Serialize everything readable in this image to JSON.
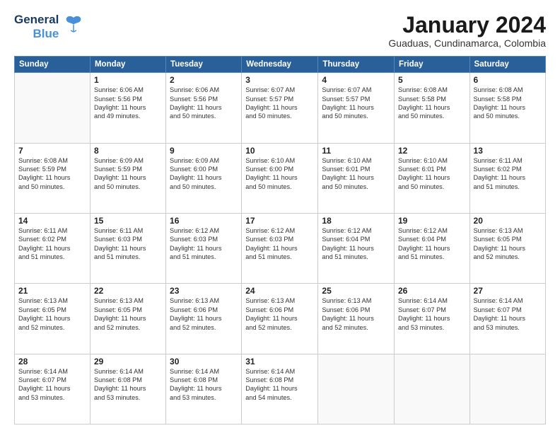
{
  "logo": {
    "line1": "General",
    "line2": "Blue"
  },
  "title": "January 2024",
  "subtitle": "Guaduas, Cundinamarca, Colombia",
  "weekdays": [
    "Sunday",
    "Monday",
    "Tuesday",
    "Wednesday",
    "Thursday",
    "Friday",
    "Saturday"
  ],
  "weeks": [
    [
      {
        "day": "",
        "info": ""
      },
      {
        "day": "1",
        "info": "Sunrise: 6:06 AM\nSunset: 5:56 PM\nDaylight: 11 hours\nand 49 minutes."
      },
      {
        "day": "2",
        "info": "Sunrise: 6:06 AM\nSunset: 5:56 PM\nDaylight: 11 hours\nand 50 minutes."
      },
      {
        "day": "3",
        "info": "Sunrise: 6:07 AM\nSunset: 5:57 PM\nDaylight: 11 hours\nand 50 minutes."
      },
      {
        "day": "4",
        "info": "Sunrise: 6:07 AM\nSunset: 5:57 PM\nDaylight: 11 hours\nand 50 minutes."
      },
      {
        "day": "5",
        "info": "Sunrise: 6:08 AM\nSunset: 5:58 PM\nDaylight: 11 hours\nand 50 minutes."
      },
      {
        "day": "6",
        "info": "Sunrise: 6:08 AM\nSunset: 5:58 PM\nDaylight: 11 hours\nand 50 minutes."
      }
    ],
    [
      {
        "day": "7",
        "info": "Sunrise: 6:08 AM\nSunset: 5:59 PM\nDaylight: 11 hours\nand 50 minutes."
      },
      {
        "day": "8",
        "info": "Sunrise: 6:09 AM\nSunset: 5:59 PM\nDaylight: 11 hours\nand 50 minutes."
      },
      {
        "day": "9",
        "info": "Sunrise: 6:09 AM\nSunset: 6:00 PM\nDaylight: 11 hours\nand 50 minutes."
      },
      {
        "day": "10",
        "info": "Sunrise: 6:10 AM\nSunset: 6:00 PM\nDaylight: 11 hours\nand 50 minutes."
      },
      {
        "day": "11",
        "info": "Sunrise: 6:10 AM\nSunset: 6:01 PM\nDaylight: 11 hours\nand 50 minutes."
      },
      {
        "day": "12",
        "info": "Sunrise: 6:10 AM\nSunset: 6:01 PM\nDaylight: 11 hours\nand 50 minutes."
      },
      {
        "day": "13",
        "info": "Sunrise: 6:11 AM\nSunset: 6:02 PM\nDaylight: 11 hours\nand 51 minutes."
      }
    ],
    [
      {
        "day": "14",
        "info": "Sunrise: 6:11 AM\nSunset: 6:02 PM\nDaylight: 11 hours\nand 51 minutes."
      },
      {
        "day": "15",
        "info": "Sunrise: 6:11 AM\nSunset: 6:03 PM\nDaylight: 11 hours\nand 51 minutes."
      },
      {
        "day": "16",
        "info": "Sunrise: 6:12 AM\nSunset: 6:03 PM\nDaylight: 11 hours\nand 51 minutes."
      },
      {
        "day": "17",
        "info": "Sunrise: 6:12 AM\nSunset: 6:03 PM\nDaylight: 11 hours\nand 51 minutes."
      },
      {
        "day": "18",
        "info": "Sunrise: 6:12 AM\nSunset: 6:04 PM\nDaylight: 11 hours\nand 51 minutes."
      },
      {
        "day": "19",
        "info": "Sunrise: 6:12 AM\nSunset: 6:04 PM\nDaylight: 11 hours\nand 51 minutes."
      },
      {
        "day": "20",
        "info": "Sunrise: 6:13 AM\nSunset: 6:05 PM\nDaylight: 11 hours\nand 52 minutes."
      }
    ],
    [
      {
        "day": "21",
        "info": "Sunrise: 6:13 AM\nSunset: 6:05 PM\nDaylight: 11 hours\nand 52 minutes."
      },
      {
        "day": "22",
        "info": "Sunrise: 6:13 AM\nSunset: 6:05 PM\nDaylight: 11 hours\nand 52 minutes."
      },
      {
        "day": "23",
        "info": "Sunrise: 6:13 AM\nSunset: 6:06 PM\nDaylight: 11 hours\nand 52 minutes."
      },
      {
        "day": "24",
        "info": "Sunrise: 6:13 AM\nSunset: 6:06 PM\nDaylight: 11 hours\nand 52 minutes."
      },
      {
        "day": "25",
        "info": "Sunrise: 6:13 AM\nSunset: 6:06 PM\nDaylight: 11 hours\nand 52 minutes."
      },
      {
        "day": "26",
        "info": "Sunrise: 6:14 AM\nSunset: 6:07 PM\nDaylight: 11 hours\nand 53 minutes."
      },
      {
        "day": "27",
        "info": "Sunrise: 6:14 AM\nSunset: 6:07 PM\nDaylight: 11 hours\nand 53 minutes."
      }
    ],
    [
      {
        "day": "28",
        "info": "Sunrise: 6:14 AM\nSunset: 6:07 PM\nDaylight: 11 hours\nand 53 minutes."
      },
      {
        "day": "29",
        "info": "Sunrise: 6:14 AM\nSunset: 6:08 PM\nDaylight: 11 hours\nand 53 minutes."
      },
      {
        "day": "30",
        "info": "Sunrise: 6:14 AM\nSunset: 6:08 PM\nDaylight: 11 hours\nand 53 minutes."
      },
      {
        "day": "31",
        "info": "Sunrise: 6:14 AM\nSunset: 6:08 PM\nDaylight: 11 hours\nand 54 minutes."
      },
      {
        "day": "",
        "info": ""
      },
      {
        "day": "",
        "info": ""
      },
      {
        "day": "",
        "info": ""
      }
    ]
  ]
}
